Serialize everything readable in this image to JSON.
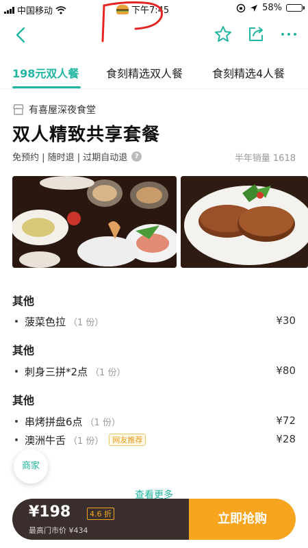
{
  "status_bar": {
    "carrier": "中国移动",
    "time": "下午7:45",
    "battery": "58%",
    "battery_level": 0.58
  },
  "nav": {
    "back_icon": "chevron-left-icon",
    "favorite_icon": "star-icon",
    "share_icon": "share-icon",
    "more_icon": "more-icon",
    "accent_color": "#1fb5a1"
  },
  "tabs": [
    {
      "label": "198元双人餐",
      "active": true
    },
    {
      "label": "食刻精选双人餐",
      "active": false
    },
    {
      "label": "食刻精选4人餐",
      "active": false
    }
  ],
  "deal": {
    "merchant": "有喜屋深夜食堂",
    "title": "双人精致共享套餐",
    "tags": "免预约 | 随时退 | 过期自动退",
    "sales": "半年销量 1618"
  },
  "menu": [
    {
      "section": "其他",
      "items": [
        {
          "name": "菠菜色拉",
          "qty": "（1 份）",
          "price": "¥30"
        }
      ]
    },
    {
      "section": "其他",
      "items": [
        {
          "name": "刺身三拼*2点",
          "qty": "（1 份）",
          "price": "¥80"
        }
      ]
    },
    {
      "section": "其他",
      "items": [
        {
          "name": "串烤拼盘6点",
          "qty": "（1 份）",
          "price": "¥72"
        },
        {
          "name": "澳洲牛舌",
          "qty": "（1 份）",
          "badge": "网友推荐",
          "price": "¥28"
        }
      ]
    }
  ],
  "see_more": "查看更多",
  "merchant_button": "商家",
  "buy_bar": {
    "price": "¥198",
    "discount": "4.6 折",
    "original": "最高门市价 ¥434",
    "button": "立即抢购",
    "button_color": "#f7a51e"
  }
}
